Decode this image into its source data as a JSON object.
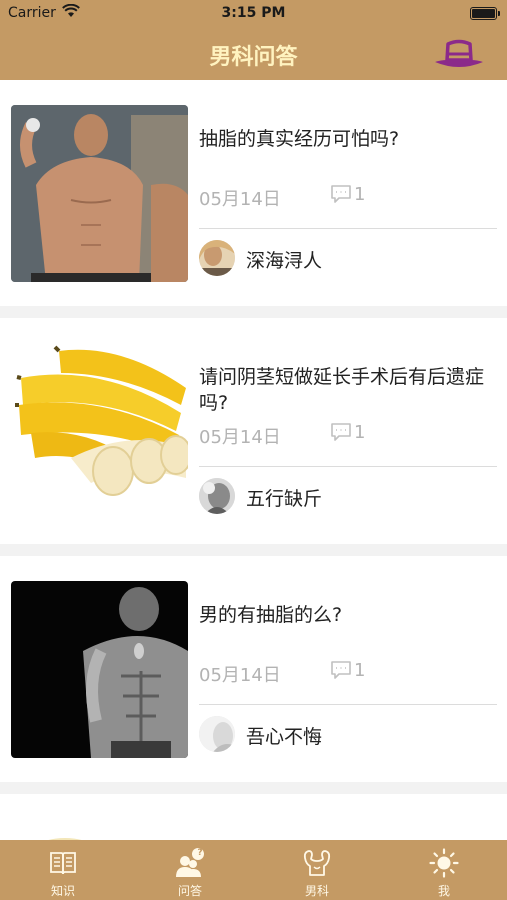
{
  "status_bar": {
    "carrier": "Carrier",
    "time": "3:15 PM"
  },
  "nav": {
    "title": "男科问答",
    "action_icon": "hat-icon"
  },
  "colors": {
    "brand": "#c49a64",
    "title": "#fff3c0",
    "hat": "#8b2a8a",
    "muted": "#b3b3b3"
  },
  "posts": [
    {
      "question": "抽脂的真实经历可怕吗?",
      "date": "05月14日",
      "comments": "1",
      "author": "深海浔人",
      "thumb": "shirtless-man-photo"
    },
    {
      "question": "请问阴茎短做延长手术后有后遗症吗?",
      "date": "05月14日",
      "comments": "1",
      "author": "五行缺斤",
      "thumb": "bananas-photo"
    },
    {
      "question": "男的有抽脂的么?",
      "date": "05月14日",
      "comments": "1",
      "author": "吾心不悔",
      "thumb": "muscular-man-photo"
    }
  ],
  "tabs": [
    {
      "label": "知识",
      "icon": "book-icon"
    },
    {
      "label": "问答",
      "icon": "qa-icon",
      "badge": "?"
    },
    {
      "label": "男科",
      "icon": "muscle-icon"
    },
    {
      "label": "我",
      "icon": "sun-icon"
    }
  ]
}
